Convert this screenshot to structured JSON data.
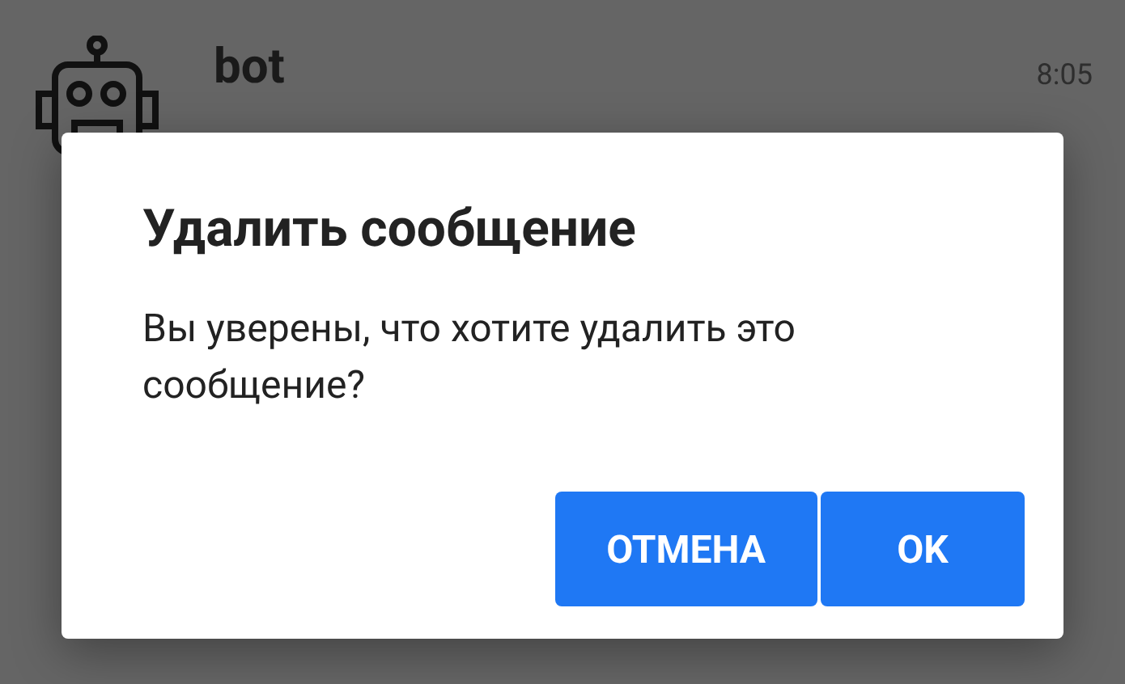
{
  "chat": {
    "name": "bot",
    "time": "8:05"
  },
  "dialog": {
    "title": "Удалить сообщение",
    "message": "Вы уверены, что хотите удалить это сообщение?",
    "buttons": [
      {
        "label": "ОТМЕНА"
      },
      {
        "label": "OK"
      }
    ]
  }
}
